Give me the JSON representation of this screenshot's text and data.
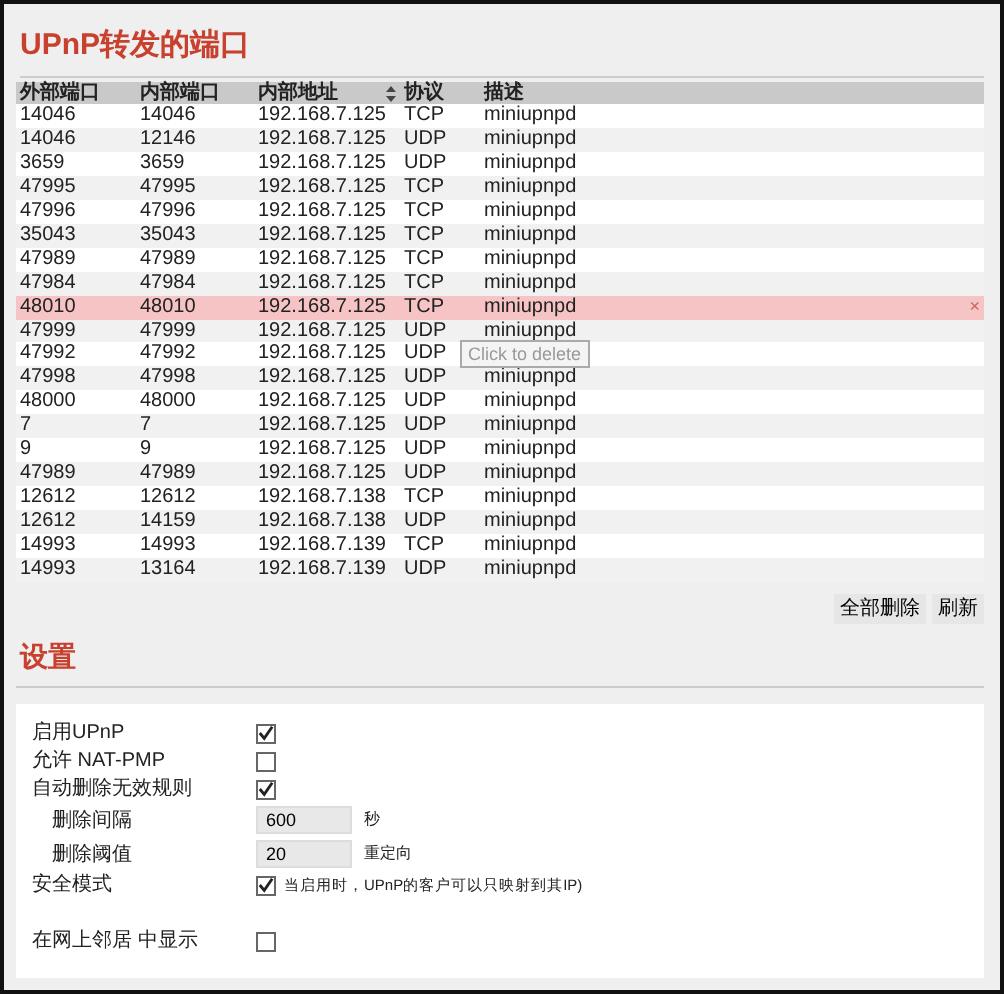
{
  "title": "UPnP转发的端口",
  "table": {
    "columns": [
      "外部端口",
      "内部端口",
      "内部地址",
      "协议",
      "描述"
    ],
    "rows": [
      {
        "cells": [
          "14046",
          "14046",
          "192.168.7.125",
          "TCP",
          "miniupnpd"
        ],
        "highlighted": false
      },
      {
        "cells": [
          "14046",
          "12146",
          "192.168.7.125",
          "UDP",
          "miniupnpd"
        ],
        "highlighted": false
      },
      {
        "cells": [
          "3659",
          "3659",
          "192.168.7.125",
          "UDP",
          "miniupnpd"
        ],
        "highlighted": false
      },
      {
        "cells": [
          "47995",
          "47995",
          "192.168.7.125",
          "TCP",
          "miniupnpd"
        ],
        "highlighted": false
      },
      {
        "cells": [
          "47996",
          "47996",
          "192.168.7.125",
          "TCP",
          "miniupnpd"
        ],
        "highlighted": false
      },
      {
        "cells": [
          "35043",
          "35043",
          "192.168.7.125",
          "TCP",
          "miniupnpd"
        ],
        "highlighted": false
      },
      {
        "cells": [
          "47989",
          "47989",
          "192.168.7.125",
          "TCP",
          "miniupnpd"
        ],
        "highlighted": false
      },
      {
        "cells": [
          "47984",
          "47984",
          "192.168.7.125",
          "TCP",
          "miniupnpd"
        ],
        "highlighted": false
      },
      {
        "cells": [
          "48010",
          "48010",
          "192.168.7.125",
          "TCP",
          "miniupnpd"
        ],
        "highlighted": true,
        "delete_icon": "×"
      },
      {
        "cells": [
          "47999",
          "47999",
          "192.168.7.125",
          "UDP",
          "miniupnpd"
        ],
        "highlighted": false
      },
      {
        "cells": [
          "47992",
          "47992",
          "192.168.7.125",
          "UDP"
        ],
        "highlighted": false,
        "tooltip": "Click to delete"
      },
      {
        "cells": [
          "47998",
          "47998",
          "192.168.7.125",
          "UDP",
          "miniupnpd"
        ],
        "highlighted": false
      },
      {
        "cells": [
          "48000",
          "48000",
          "192.168.7.125",
          "UDP",
          "miniupnpd"
        ],
        "highlighted": false
      },
      {
        "cells": [
          "7",
          "7",
          "192.168.7.125",
          "UDP",
          "miniupnpd"
        ],
        "highlighted": false
      },
      {
        "cells": [
          "9",
          "9",
          "192.168.7.125",
          "UDP",
          "miniupnpd"
        ],
        "highlighted": false
      },
      {
        "cells": [
          "47989",
          "47989",
          "192.168.7.125",
          "UDP",
          "miniupnpd"
        ],
        "highlighted": false
      },
      {
        "cells": [
          "12612",
          "12612",
          "192.168.7.138",
          "TCP",
          "miniupnpd"
        ],
        "highlighted": false
      },
      {
        "cells": [
          "12612",
          "14159",
          "192.168.7.138",
          "UDP",
          "miniupnpd"
        ],
        "highlighted": false
      },
      {
        "cells": [
          "14993",
          "14993",
          "192.168.7.139",
          "TCP",
          "miniupnpd"
        ],
        "highlighted": false
      },
      {
        "cells": [
          "14993",
          "13164",
          "192.168.7.139",
          "UDP",
          "miniupnpd"
        ],
        "highlighted": false
      }
    ]
  },
  "buttons": [
    "全部删除",
    "刷新"
  ],
  "settings_title": "设置",
  "settings": [
    {
      "kind": "checkbox",
      "label": "启用UPnP",
      "checked": true
    },
    {
      "kind": "checkbox",
      "label": "允许 NAT-PMP",
      "checked": false
    },
    {
      "kind": "checkbox",
      "label": "自动删除无效规则",
      "checked": true,
      "children": [
        {
          "kind": "number",
          "label": "删除间隔",
          "value": "600",
          "unit": "秒"
        },
        {
          "kind": "number",
          "label": "删除阈值",
          "value": "20",
          "unit": "重定向"
        }
      ]
    },
    {
      "kind": "checkbox",
      "label": "安全模式",
      "checked": true,
      "hint": "当启用时，UPnP的客户可以只映射到其IP)"
    },
    {
      "kind": "spacer"
    },
    {
      "kind": "checkbox",
      "label": "在网上邻居 中显示",
      "checked": false
    }
  ]
}
